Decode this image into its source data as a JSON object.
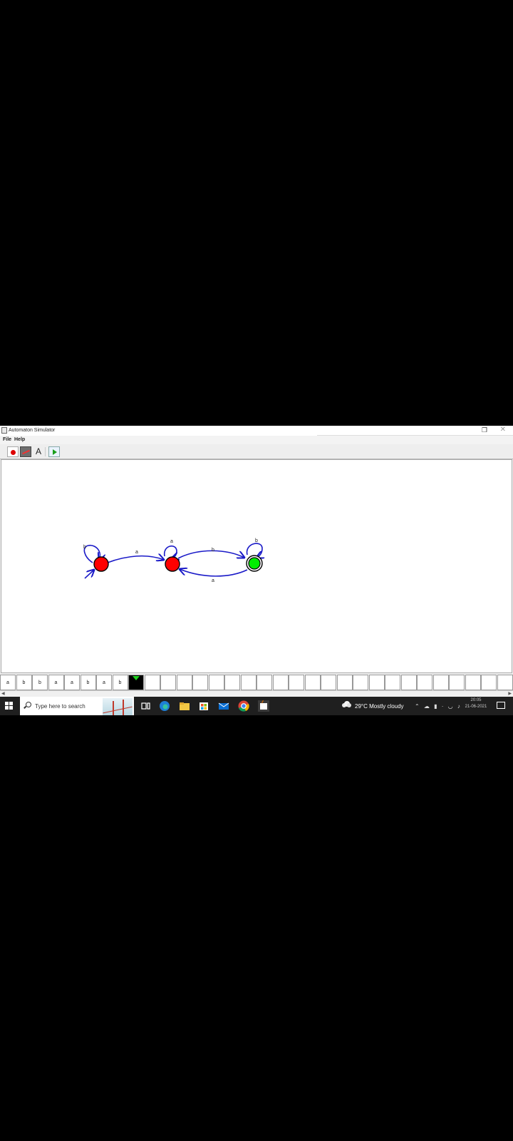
{
  "window": {
    "title": "Automaton Simulator"
  },
  "menu": {
    "file": "File",
    "help": "Help"
  },
  "toolbar": {
    "text_tool": "A"
  },
  "automaton": {
    "states": [
      {
        "id": "q0",
        "color": "#ff0000",
        "accepting": false,
        "start": true
      },
      {
        "id": "q1",
        "color": "#ff0000",
        "accepting": false,
        "start": false
      },
      {
        "id": "q2",
        "color": "#00ee00",
        "accepting": true,
        "start": false
      }
    ],
    "transitions": [
      {
        "from": "q0",
        "to": "q0",
        "label": "b"
      },
      {
        "from": "q0",
        "to": "q1",
        "label": "a"
      },
      {
        "from": "q1",
        "to": "q1",
        "label": "a"
      },
      {
        "from": "q1",
        "to": "q2",
        "label": "b"
      },
      {
        "from": "q2",
        "to": "q2",
        "label": "b"
      },
      {
        "from": "q2",
        "to": "q1",
        "label": "a"
      }
    ],
    "edge_color": "#1a1ac8"
  },
  "tape": {
    "symbols": [
      "a",
      "b",
      "b",
      "a",
      "a",
      "b",
      "a",
      "b"
    ],
    "head_cell": 8,
    "total_cells": 33
  },
  "taskbar": {
    "search_placeholder": "Type here to search",
    "weather": "29°C  Mostly cloudy",
    "time": "20:05",
    "date": "21-06-2021"
  }
}
